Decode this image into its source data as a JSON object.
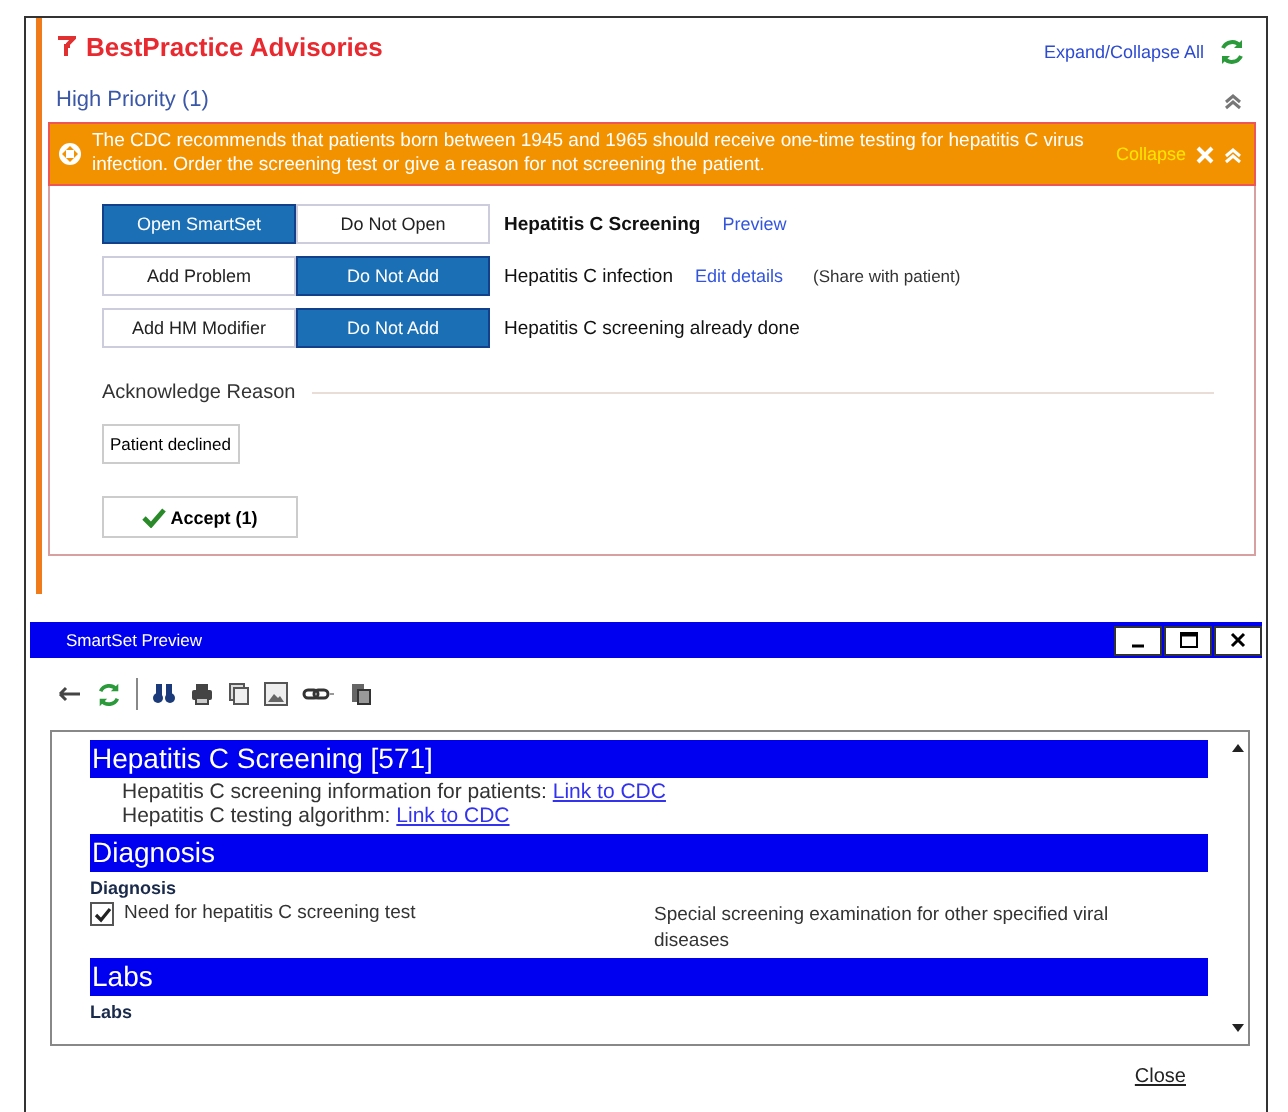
{
  "advisories": {
    "title": "BestPractice Advisories",
    "expand_collapse_all": "Expand/Collapse All",
    "group": {
      "title": "High Priority (1)",
      "expanded": true
    },
    "alert": {
      "message": "The CDC recommends that patients born between 1945 and 1965 should receive one-time testing for hepatitis C virus infection. Order the screening test or give a reason for not screening the patient.",
      "collapse": "Collapse"
    },
    "rows": [
      {
        "buttons": [
          {
            "label": "Open SmartSet",
            "selected": true
          },
          {
            "label": "Do Not Open",
            "selected": false
          }
        ],
        "text": "Hepatitis C Screening",
        "bold": true,
        "link": "Preview"
      },
      {
        "buttons": [
          {
            "label": "Add Problem",
            "selected": false
          },
          {
            "label": "Do Not Add",
            "selected": true
          }
        ],
        "text": "Hepatitis C infection",
        "bold": false,
        "link": "Edit details",
        "note": "(Share with patient)"
      },
      {
        "buttons": [
          {
            "label": "Add HM Modifier",
            "selected": false
          },
          {
            "label": "Do Not Add",
            "selected": true
          }
        ],
        "text": "Hepatitis C screening already done",
        "bold": false
      }
    ],
    "acknowledge": {
      "title": "Acknowledge Reason",
      "reasons": [
        {
          "label": "Patient declined",
          "selected": false
        }
      ]
    },
    "accept": "Accept (1)"
  },
  "preview": {
    "title": "SmartSet Preview",
    "sections": [
      {
        "heading": "Hepatitis C Screening [571]",
        "lines": [
          {
            "text": "Hepatitis C screening information for patients:",
            "link": "Link to CDC"
          },
          {
            "text": "Hepatitis C testing algorithm:",
            "link": "Link to CDC"
          }
        ]
      },
      {
        "heading": "Diagnosis",
        "subheading": "Diagnosis",
        "items": [
          {
            "label": "Need for hepatitis C screening test",
            "checked": true,
            "description": "Special screening examination for other specified viral diseases"
          }
        ]
      },
      {
        "heading": "Labs",
        "subheading": "Labs"
      }
    ],
    "close": "Close"
  }
}
